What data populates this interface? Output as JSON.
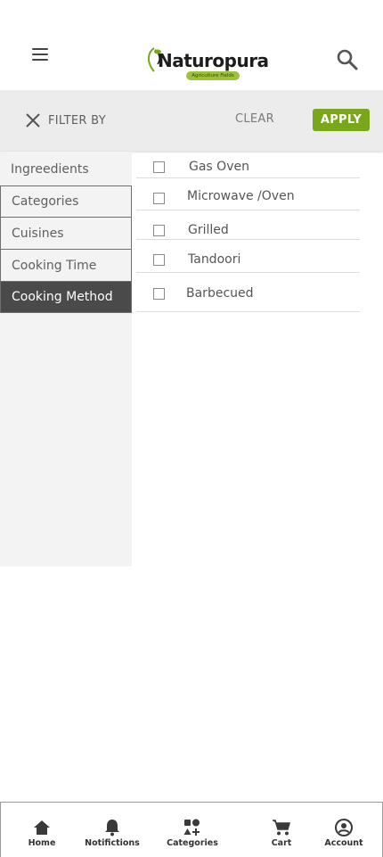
{
  "header": {
    "brand_name": "Naturopura",
    "brand_tagline": "Agriculture Fields",
    "menu_icon": "hamburger-menu-icon",
    "search_icon": "search-icon"
  },
  "filter": {
    "title": "FILTER BY",
    "clear_label": "CLEAR",
    "apply_label": "APPLY",
    "accent_color": "#7aa61a"
  },
  "sidebar": {
    "items": [
      {
        "label": "Ingreedients",
        "active": false
      },
      {
        "label": "Categories",
        "active": false
      },
      {
        "label": "Cuisines",
        "active": false
      },
      {
        "label": "Cooking Time",
        "active": false
      },
      {
        "label": "Cooking Method",
        "active": true
      }
    ]
  },
  "options": [
    {
      "label": "Gas Oven",
      "checked": false
    },
    {
      "label": "Microwave /Oven",
      "checked": false
    },
    {
      "label": "Grilled",
      "checked": false
    },
    {
      "label": "Tandoori",
      "checked": false
    },
    {
      "label": "Barbecued",
      "checked": false
    }
  ],
  "bottom_nav": [
    {
      "label": "Home",
      "icon": "home-icon"
    },
    {
      "label": "Notifictions",
      "icon": "bell-icon"
    },
    {
      "label": "Categories",
      "icon": "categories-icon"
    },
    {
      "label": "Cart",
      "icon": "cart-icon"
    },
    {
      "label": "Account",
      "icon": "account-icon"
    }
  ]
}
